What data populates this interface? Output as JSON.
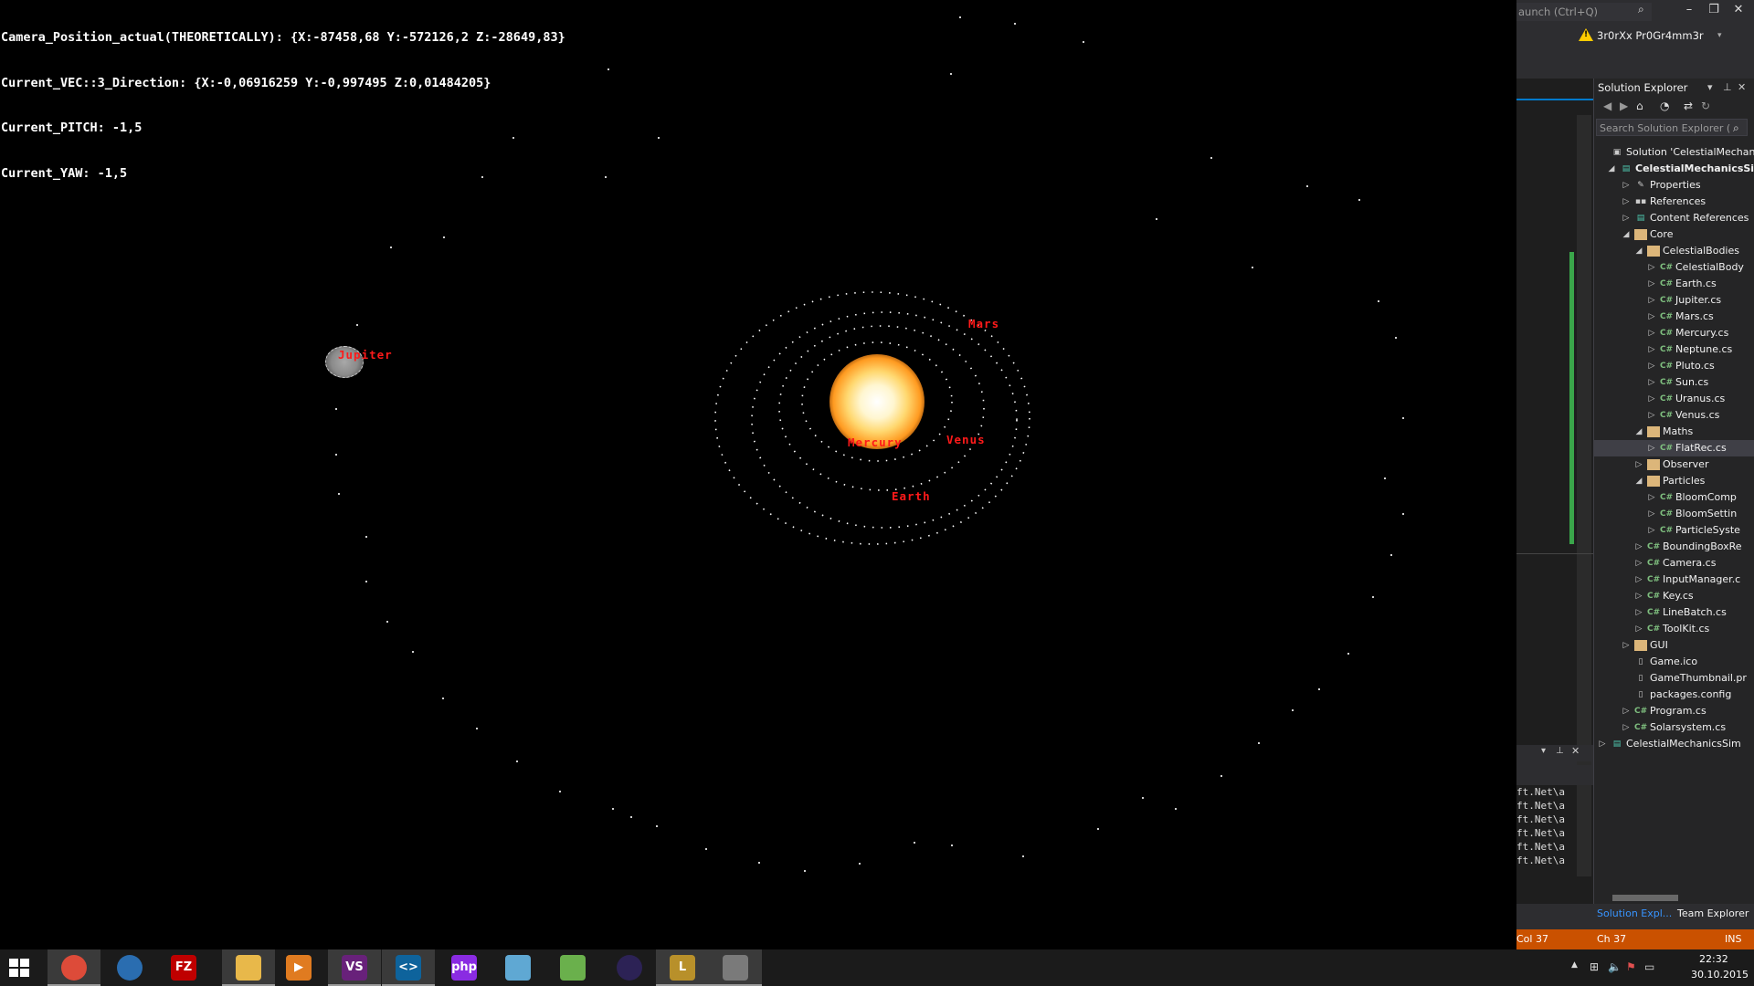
{
  "debug": {
    "line1": "Camera_Position_actual(THEORETICALLY): {X:-87458,68 Y:-572126,2 Z:-28649,83}",
    "line2": "Current_VEC::3_Direction: {X:-0,06916259 Y:-0,997495 Z:0,01484205}",
    "line3": "Current_PITCH: -1,5",
    "line4": "Current_YAW: -1,5"
  },
  "planets": {
    "jupiter": "Jupiter",
    "mars": "Mars",
    "venus": "Venus",
    "mercury": "Mercury",
    "earth": "Earth"
  },
  "vs": {
    "quick_launch": "aunch (Ctrl+Q)",
    "account": "3r0rXx Pr0Gr4mm3r",
    "solution_explorer_title": "Solution Explorer",
    "search_placeholder": "Search Solution Explorer (",
    "output_lines": [
      "ft.Net\\a",
      "ft.Net\\a",
      "ft.Net\\a",
      "ft.Net\\a",
      "ft.Net\\a",
      "ft.Net\\a"
    ],
    "tabs": {
      "solution": "Solution Expl...",
      "team": "Team Explorer"
    },
    "status": {
      "col": "Col 37",
      "ch": "Ch 37",
      "ins": "INS"
    }
  },
  "tree": [
    {
      "label": "Solution 'CelestialMechani",
      "icon": "sln",
      "arrow": "",
      "bold": false
    },
    {
      "label": "CelestialMechanicsSim",
      "icon": "proj",
      "arrow": "◢",
      "bold": true
    },
    {
      "label": "Properties",
      "icon": "prop",
      "arrow": "▷",
      "bold": false
    },
    {
      "label": "References",
      "icon": "ref",
      "arrow": "▷",
      "bold": false
    },
    {
      "label": "Content References",
      "icon": "proj",
      "arrow": "▷",
      "bold": false
    },
    {
      "label": "Core",
      "icon": "folder",
      "arrow": "◢",
      "bold": false
    },
    {
      "label": "CelestialBodies",
      "icon": "folder",
      "arrow": "◢",
      "bold": false
    },
    {
      "label": "CelestialBody",
      "icon": "cs",
      "arrow": "▷",
      "bold": false
    },
    {
      "label": "Earth.cs",
      "icon": "cs",
      "arrow": "▷",
      "bold": false
    },
    {
      "label": "Jupiter.cs",
      "icon": "cs",
      "arrow": "▷",
      "bold": false
    },
    {
      "label": "Mars.cs",
      "icon": "cs",
      "arrow": "▷",
      "bold": false
    },
    {
      "label": "Mercury.cs",
      "icon": "cs",
      "arrow": "▷",
      "bold": false
    },
    {
      "label": "Neptune.cs",
      "icon": "cs",
      "arrow": "▷",
      "bold": false
    },
    {
      "label": "Pluto.cs",
      "icon": "cs",
      "arrow": "▷",
      "bold": false
    },
    {
      "label": "Sun.cs",
      "icon": "cs",
      "arrow": "▷",
      "bold": false
    },
    {
      "label": "Uranus.cs",
      "icon": "cs",
      "arrow": "▷",
      "bold": false
    },
    {
      "label": "Venus.cs",
      "icon": "cs",
      "arrow": "▷",
      "bold": false
    },
    {
      "label": "Maths",
      "icon": "folder",
      "arrow": "◢",
      "bold": false
    },
    {
      "label": "FlatRec.cs",
      "icon": "cs",
      "arrow": "▷",
      "bold": false,
      "selected": true
    },
    {
      "label": "Observer",
      "icon": "folder",
      "arrow": "▷",
      "bold": false
    },
    {
      "label": "Particles",
      "icon": "folder",
      "arrow": "◢",
      "bold": false
    },
    {
      "label": "BloomComp",
      "icon": "cs",
      "arrow": "▷",
      "bold": false
    },
    {
      "label": "BloomSettin",
      "icon": "cs",
      "arrow": "▷",
      "bold": false
    },
    {
      "label": "ParticleSyste",
      "icon": "cs",
      "arrow": "▷",
      "bold": false
    },
    {
      "label": "BoundingBoxRe",
      "icon": "cs",
      "arrow": "▷",
      "bold": false
    },
    {
      "label": "Camera.cs",
      "icon": "cs",
      "arrow": "▷",
      "bold": false
    },
    {
      "label": "InputManager.c",
      "icon": "cs",
      "arrow": "▷",
      "bold": false
    },
    {
      "label": "Key.cs",
      "icon": "cs",
      "arrow": "▷",
      "bold": false
    },
    {
      "label": "LineBatch.cs",
      "icon": "cs",
      "arrow": "▷",
      "bold": false
    },
    {
      "label": "ToolKit.cs",
      "icon": "cs",
      "arrow": "▷",
      "bold": false
    },
    {
      "label": "GUI",
      "icon": "folder",
      "arrow": "▷",
      "bold": false
    },
    {
      "label": "Game.ico",
      "icon": "file",
      "arrow": "",
      "bold": false
    },
    {
      "label": "GameThumbnail.pr",
      "icon": "file",
      "arrow": "",
      "bold": false
    },
    {
      "label": "packages.config",
      "icon": "file",
      "arrow": "",
      "bold": false
    },
    {
      "label": "Program.cs",
      "icon": "cs",
      "arrow": "▷",
      "bold": false
    },
    {
      "label": "Solarsystem.cs",
      "icon": "cs",
      "arrow": "▷",
      "bold": false
    },
    {
      "label": "CelestialMechanicsSim",
      "icon": "proj",
      "arrow": "▷",
      "bold": false
    }
  ],
  "taskbar": {
    "apps": [
      {
        "name": "chrome-icon",
        "text": "",
        "color": "#dd4b39",
        "active": true
      },
      {
        "name": "thunderbird-icon",
        "text": "",
        "color": "#2a6db0",
        "active": false
      },
      {
        "name": "filezilla-icon",
        "text": "FZ",
        "color": "#bf0000",
        "active": false
      },
      {
        "name": "file-explorer-icon",
        "text": "",
        "color": "#e8b84a",
        "active": true
      },
      {
        "name": "media-player-icon",
        "text": "▶",
        "color": "#e07b20",
        "active": false
      },
      {
        "name": "visual-studio-icon",
        "text": "VS",
        "color": "#68217a",
        "active": true
      },
      {
        "name": "vs-code-icon",
        "text": "<>",
        "color": "#0e639c",
        "active": true
      },
      {
        "name": "phpstorm-icon",
        "text": "php",
        "color": "#8a2be2",
        "active": false
      },
      {
        "name": "notepad-icon",
        "text": "",
        "color": "#5fa8d3",
        "active": false
      },
      {
        "name": "colorful-app-icon",
        "text": "",
        "color": "#6ab04c",
        "active": false
      },
      {
        "name": "eclipse-icon",
        "text": "",
        "color": "#2c2255",
        "active": false
      },
      {
        "name": "league-icon",
        "text": "L",
        "color": "#b8902a",
        "active": true
      },
      {
        "name": "game-controller-icon",
        "text": "",
        "color": "#7a7a7a",
        "active": true
      }
    ],
    "time": "22:32",
    "date": "30.10.2015"
  }
}
